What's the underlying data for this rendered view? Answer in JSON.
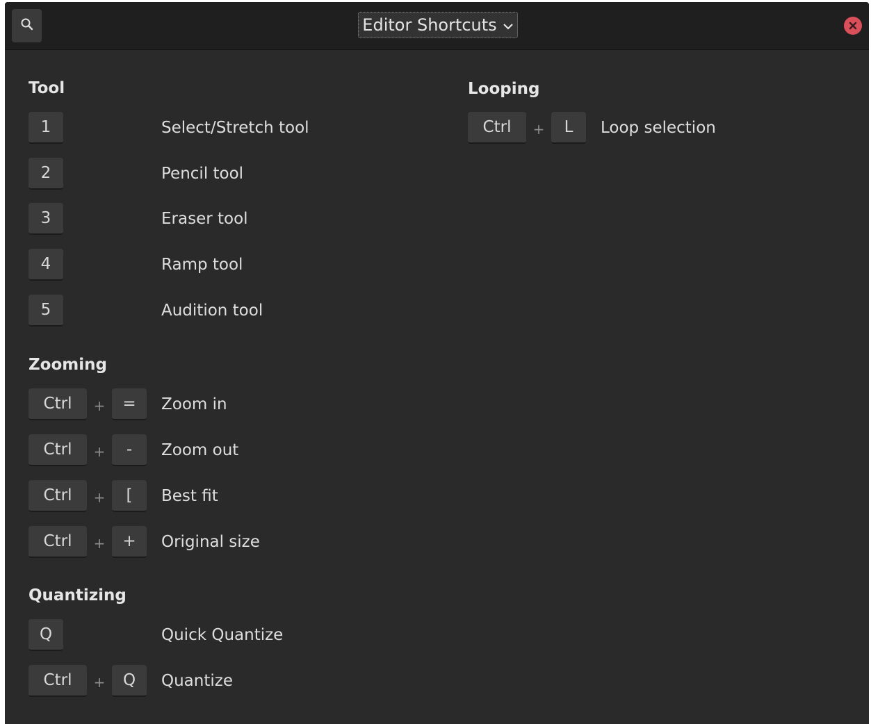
{
  "header": {
    "title": "Editor Shortcuts",
    "search_icon": "search-icon",
    "dropdown_icon": "chevron-down-icon",
    "close_icon": "close-icon",
    "close_color": "#d94f5a"
  },
  "sections": {
    "tool": {
      "title": "Tool",
      "rows": [
        {
          "keys": [
            "1"
          ],
          "label": "Select/Stretch tool"
        },
        {
          "keys": [
            "2"
          ],
          "label": "Pencil tool"
        },
        {
          "keys": [
            "3"
          ],
          "label": "Eraser tool"
        },
        {
          "keys": [
            "4"
          ],
          "label": "Ramp tool"
        },
        {
          "keys": [
            "5"
          ],
          "label": "Audition tool"
        }
      ]
    },
    "zooming": {
      "title": "Zooming",
      "rows": [
        {
          "keys": [
            "Ctrl",
            "="
          ],
          "label": "Zoom in"
        },
        {
          "keys": [
            "Ctrl",
            "-"
          ],
          "label": "Zoom out"
        },
        {
          "keys": [
            "Ctrl",
            "["
          ],
          "label": "Best fit"
        },
        {
          "keys": [
            "Ctrl",
            "+"
          ],
          "label": "Original size"
        }
      ]
    },
    "quantizing": {
      "title": "Quantizing",
      "rows": [
        {
          "keys": [
            "Q"
          ],
          "label": "Quick Quantize"
        },
        {
          "keys": [
            "Ctrl",
            "Q"
          ],
          "label": "Quantize"
        }
      ]
    },
    "looping": {
      "title": "Looping",
      "rows": [
        {
          "keys": [
            "Ctrl",
            "L"
          ],
          "label": "Loop selection"
        }
      ]
    }
  },
  "plus_symbol": "+"
}
